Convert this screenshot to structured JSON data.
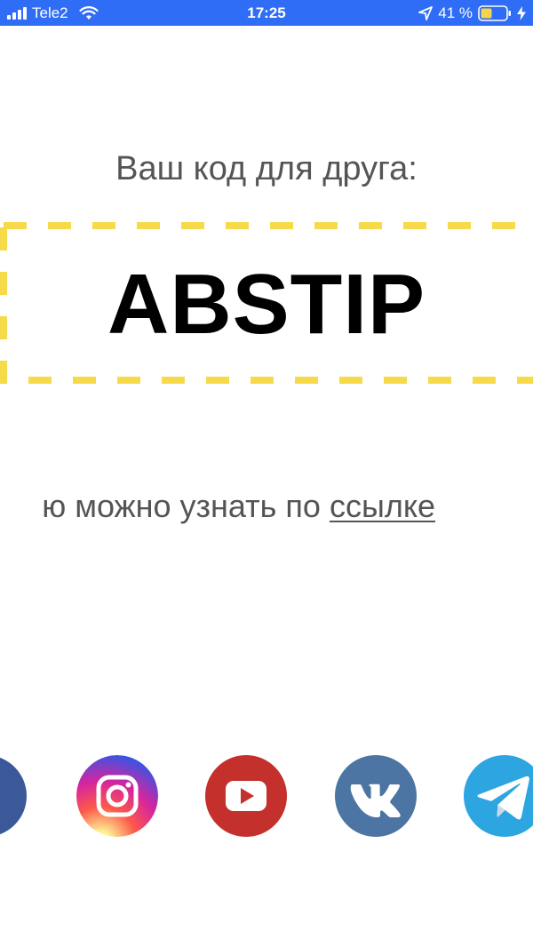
{
  "status_bar": {
    "carrier": "Tele2",
    "time": "17:25",
    "battery_percent": "41 %",
    "background_color": "#2f6df6",
    "icons": [
      "signal-icon",
      "wifi-icon",
      "location-icon",
      "battery-icon",
      "charging-icon"
    ]
  },
  "main": {
    "heading": "Ваш код для друга:",
    "code": "ABSTIP",
    "info_text": "ю можно узнать по ",
    "info_link": "ссылке",
    "code_border_color": "#f6da4a"
  },
  "social": {
    "items": [
      "facebook-icon",
      "instagram-icon",
      "youtube-icon",
      "vk-icon",
      "telegram-icon"
    ],
    "colors": {
      "facebook": "#3b5998",
      "youtube": "#c4302b",
      "vk": "#4c75a3",
      "telegram": "#2ca5e0"
    }
  }
}
